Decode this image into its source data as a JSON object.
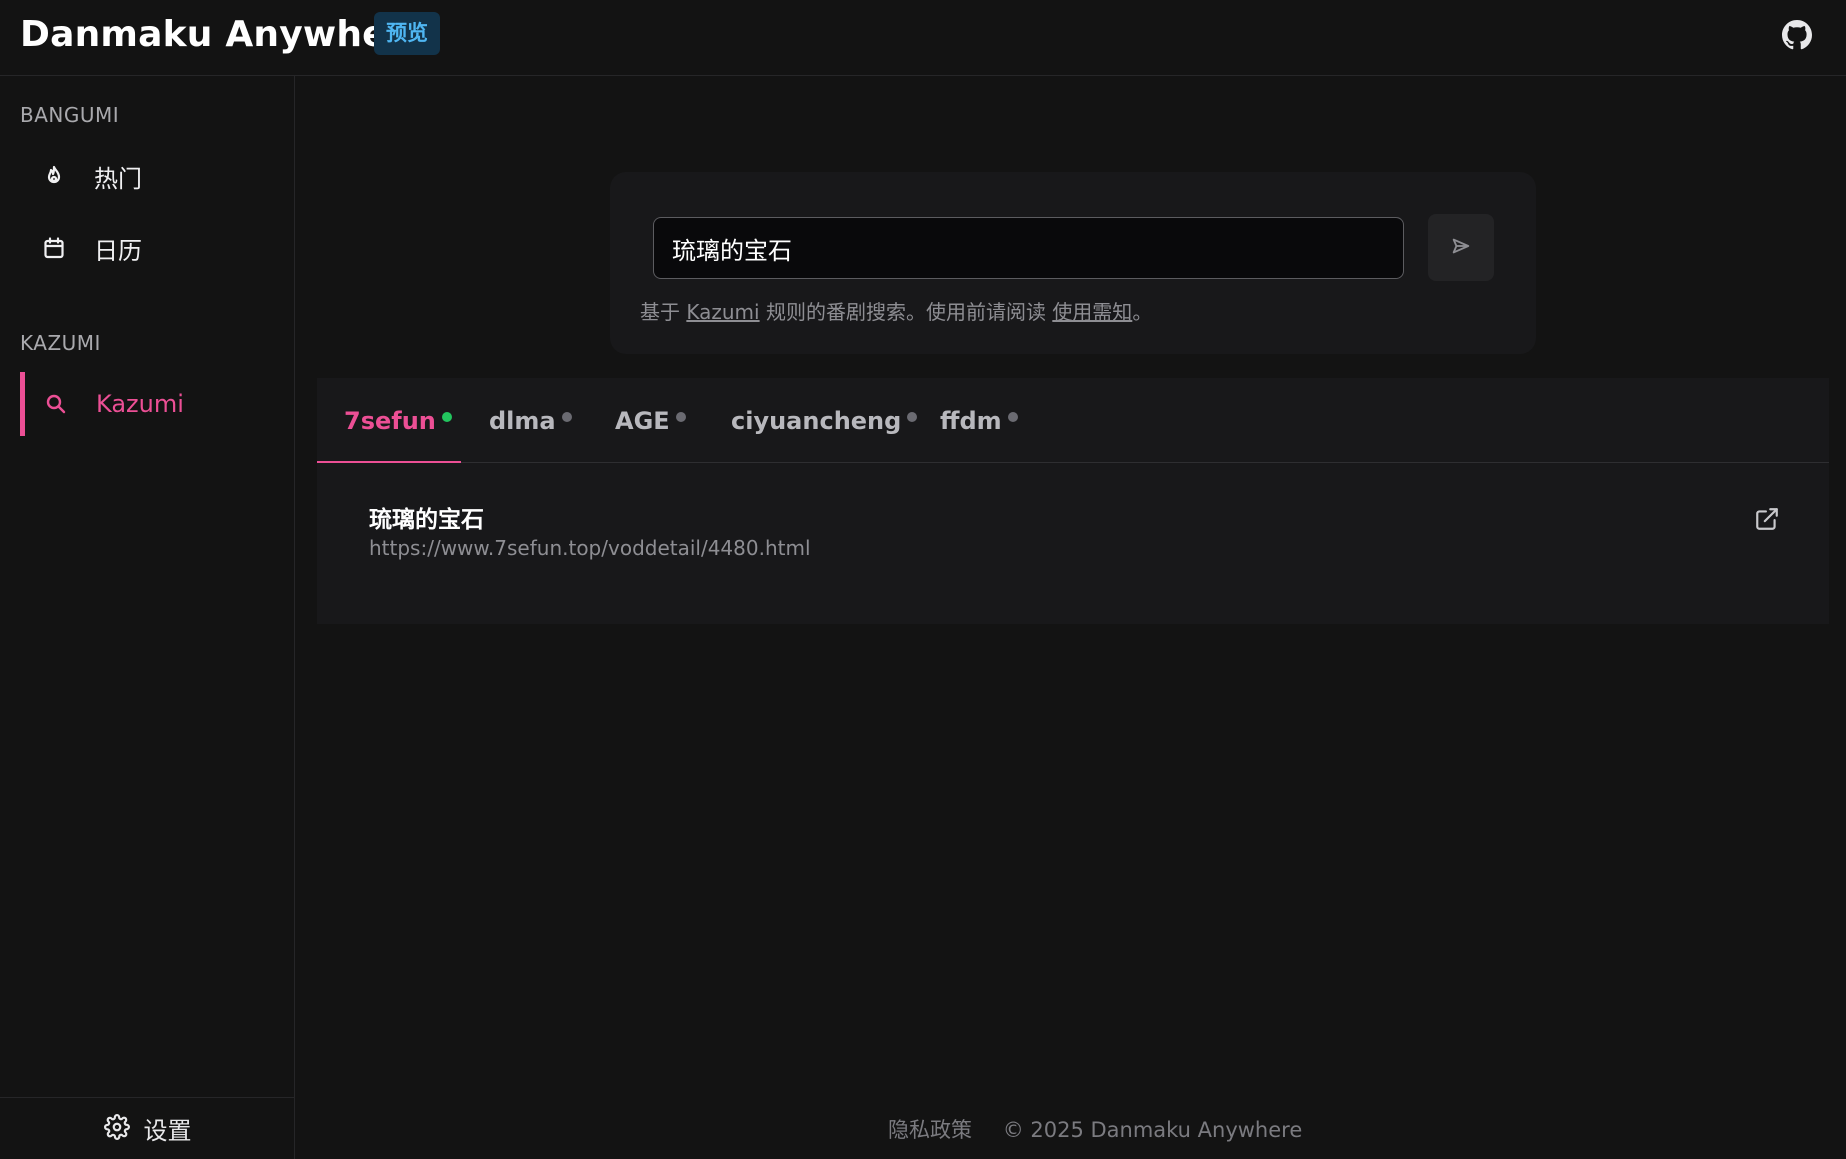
{
  "header": {
    "app_title": "Danmaku Anywhere",
    "badge": "预览",
    "github_icon": "github-icon"
  },
  "sidebar": {
    "sections": [
      {
        "title": "BANGUMI",
        "items": [
          {
            "label": "热门",
            "icon": "flame-icon"
          },
          {
            "label": "日历",
            "icon": "calendar-icon"
          }
        ]
      },
      {
        "title": "KAZUMI",
        "items": [
          {
            "label": "Kazumi",
            "icon": "search-icon",
            "active": true
          }
        ]
      }
    ],
    "settings_label": "设置"
  },
  "search": {
    "value": "琉璃的宝石",
    "hint_prefix": "基于",
    "hint_link1": "Kazumi",
    "hint_middle": "规则的番剧搜索。使用前请阅读",
    "hint_link2": "使用需知",
    "hint_suffix": "。"
  },
  "tabs": [
    {
      "label": "7sefun",
      "status": "online"
    },
    {
      "label": "dlma",
      "status": "idle"
    },
    {
      "label": "AGE",
      "status": "idle"
    },
    {
      "label": "ciyuancheng",
      "status": "idle"
    },
    {
      "label": "ffdm",
      "status": "idle"
    }
  ],
  "results": [
    {
      "title": "琉璃的宝石",
      "url": "https://www.7sefun.top/voddetail/4480.html"
    }
  ],
  "footer": {
    "privacy": "隐私政策",
    "copyright": "© 2025 Danmaku Anywhere"
  },
  "colors": {
    "accent": "#ec4f95",
    "online": "#22c55e",
    "badge_bg": "#12334a",
    "badge_text": "#4fb6f2"
  }
}
